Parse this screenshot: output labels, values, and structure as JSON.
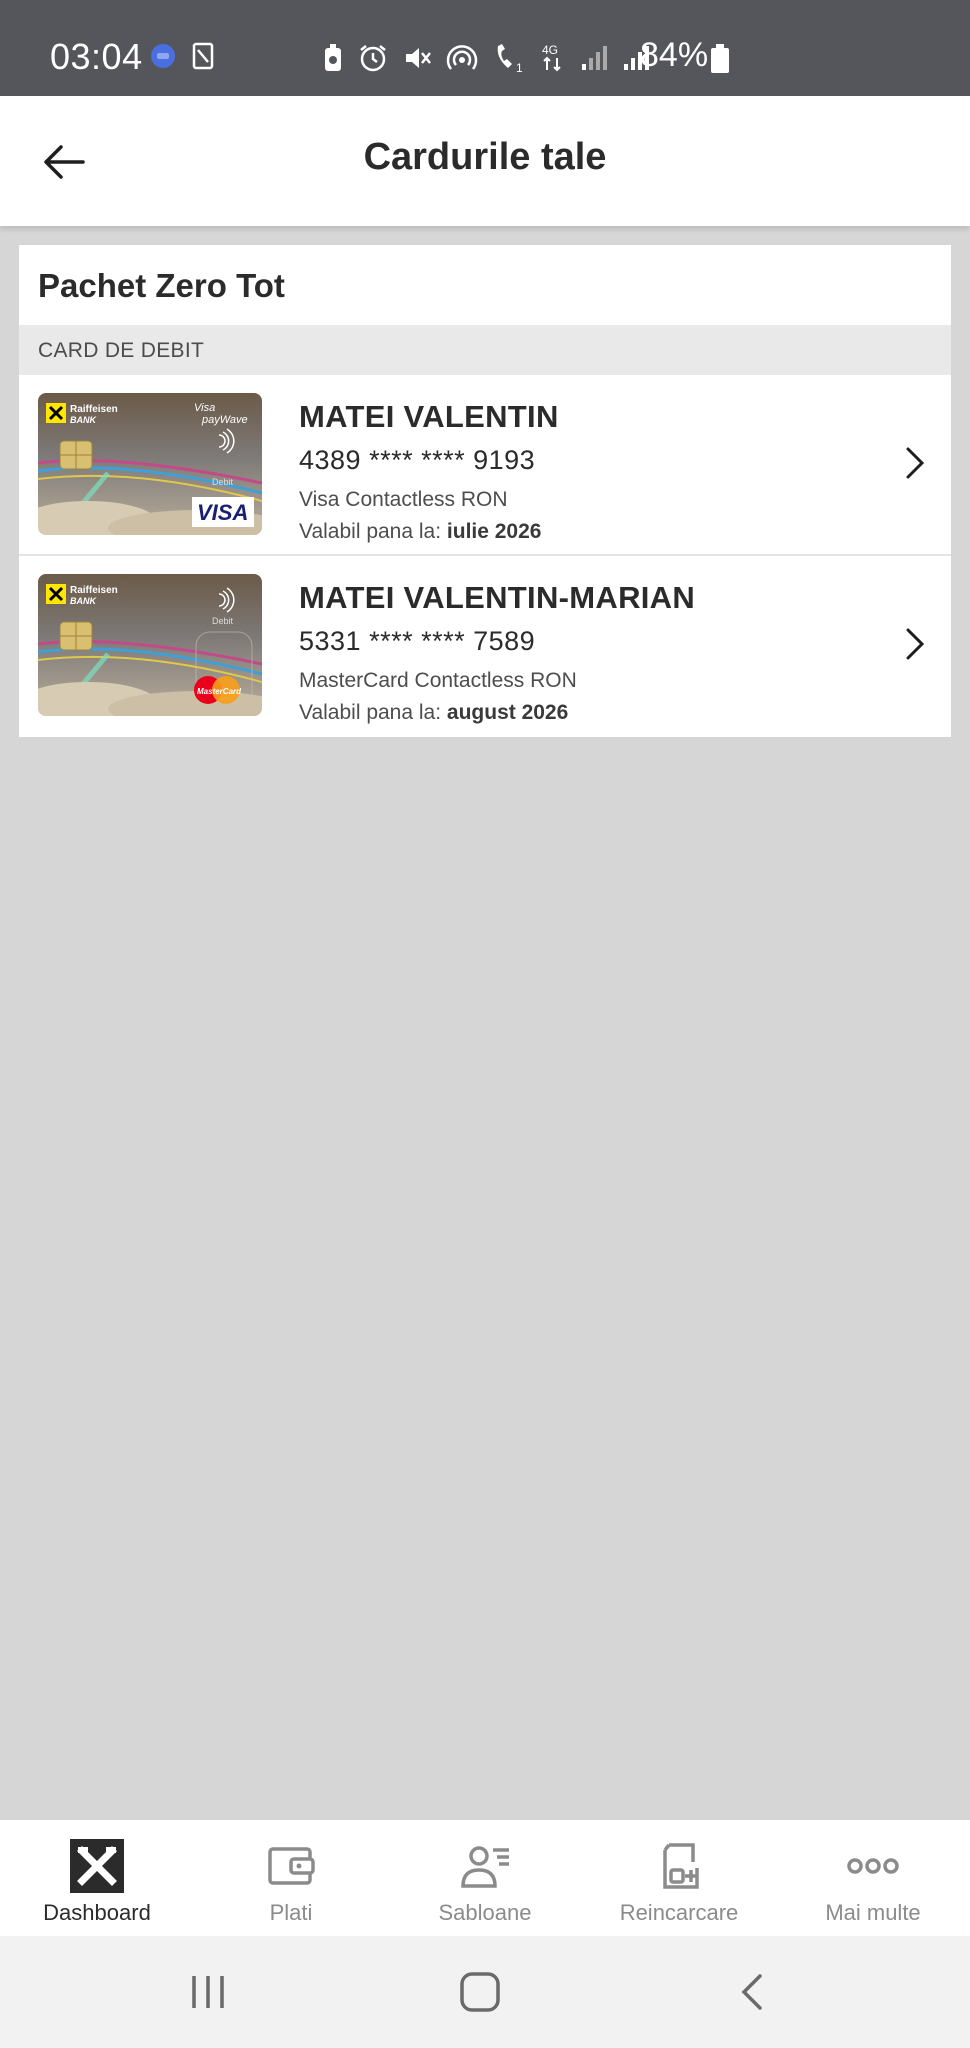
{
  "status_bar": {
    "time": "03:04",
    "network": "4G",
    "battery": "84%",
    "icons": [
      "meet-icon",
      "sim-card-icon",
      "battery-saver-icon",
      "alarm-icon",
      "mute-icon",
      "hotspot-icon",
      "wifi-calling-icon",
      "data-arrows-icon",
      "signal-icon",
      "signal-icon",
      "battery-icon"
    ]
  },
  "header": {
    "title": "Cardurile tale",
    "back_icon": "arrow-left-icon"
  },
  "package": {
    "title": "Pachet Zero Tot",
    "section_label": "CARD DE DEBIT",
    "cards": [
      {
        "holder": "MATEI VALENTIN",
        "number": "4389 **** **** 9193",
        "type": "Visa Contactless RON",
        "expiry_label": "Valabil pana la:",
        "expiry_value": "iulie 2026",
        "brand": "VISA",
        "card_bank_line1": "Raiffeisen",
        "card_bank_line2": "BANK",
        "card_top_right": "Visa payWave",
        "card_debit": "Debit"
      },
      {
        "holder": "MATEI VALENTIN-MARIAN",
        "number": "5331 **** **** 7589",
        "type": "MasterCard Contactless RON",
        "expiry_label": "Valabil pana la:",
        "expiry_value": "august 2026",
        "brand": "MasterCard",
        "card_bank_line1": "Raiffeisen",
        "card_bank_line2": "BANK",
        "card_top_right": "",
        "card_debit": "Debit"
      }
    ]
  },
  "bottom_nav": {
    "items": [
      {
        "label": "Dashboard",
        "icon": "raiffeisen-logo-icon",
        "active": true
      },
      {
        "label": "Plati",
        "icon": "wallet-icon",
        "active": false
      },
      {
        "label": "Sabloane",
        "icon": "user-template-icon",
        "active": false
      },
      {
        "label": "Reincarcare",
        "icon": "recharge-icon",
        "active": false
      },
      {
        "label": "Mai multe",
        "icon": "more-dots-icon",
        "active": false
      }
    ]
  },
  "colors": {
    "status_bar": "#55565b",
    "background": "#d6d6d6",
    "section_bg": "#e8e9e8",
    "text_primary": "#2b2b2b",
    "nav_inactive": "#8b8b8b"
  }
}
